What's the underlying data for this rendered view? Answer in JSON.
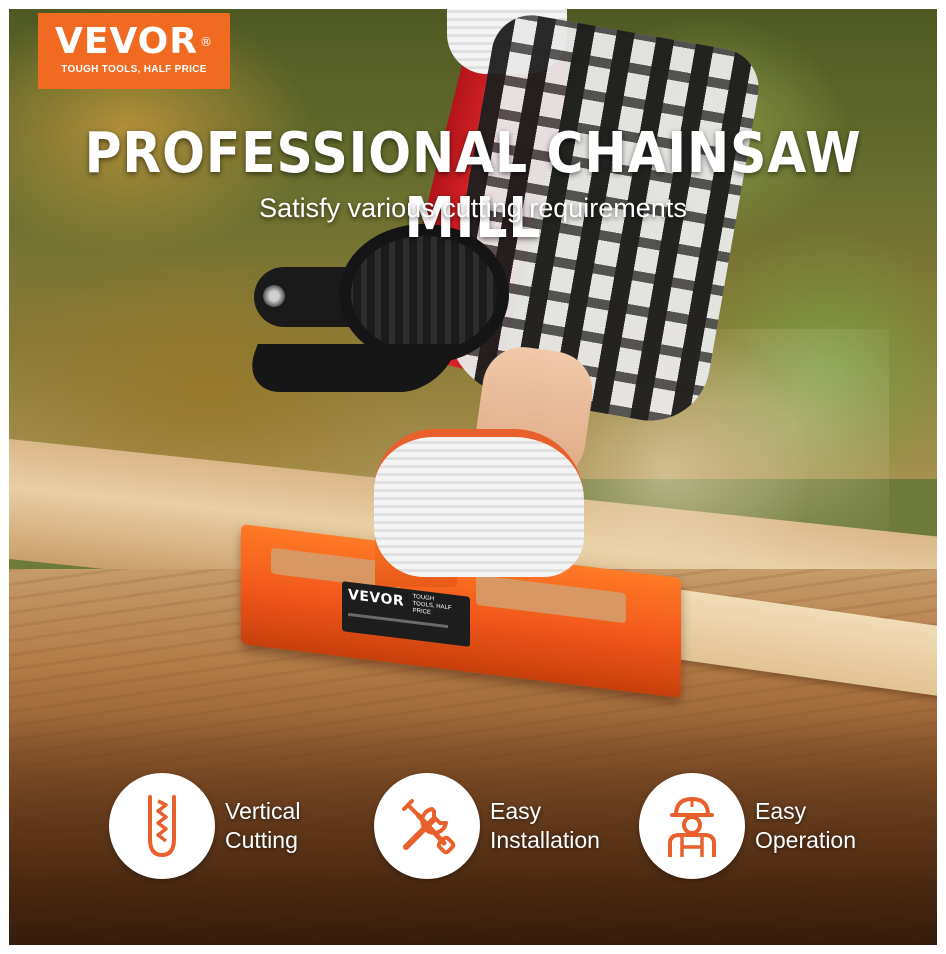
{
  "brand": {
    "name": "VEVOR",
    "registered_mark": "®",
    "tagline": "TOUGH TOOLS, HALF PRICE",
    "color": "#f06a22"
  },
  "headline": "PROFESSIONAL CHAINSAW MILL",
  "subheadline": "Satisfy various cutting requirements",
  "product_label": {
    "brand": "VEVOR",
    "tagline": "TOUGH TOOLS, HALF PRICE"
  },
  "features": [
    {
      "icon": "vertical-cutting-icon",
      "line1": "Vertical",
      "line2": "Cutting"
    },
    {
      "icon": "tools-icon",
      "line1": "Easy",
      "line2": "Installation"
    },
    {
      "icon": "worker-icon",
      "line1": "Easy",
      "line2": "Operation"
    }
  ],
  "colors": {
    "accent": "#f06a22",
    "icon_stroke": "#e8602c",
    "text": "#ffffff"
  }
}
